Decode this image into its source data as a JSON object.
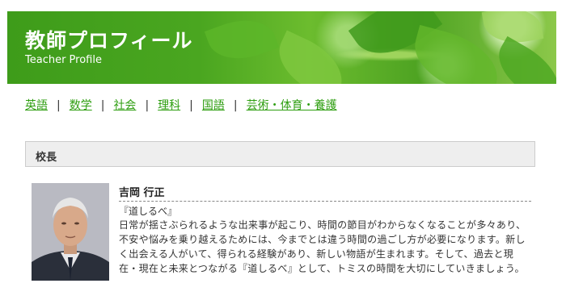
{
  "header": {
    "title": "教師プロフィール",
    "subtitle": "Teacher Profile"
  },
  "nav": {
    "items": [
      {
        "label": "英語"
      },
      {
        "label": "数学"
      },
      {
        "label": "社会"
      },
      {
        "label": "理科"
      },
      {
        "label": "国語"
      },
      {
        "label": "芸術・体育・養護"
      }
    ],
    "separators": [
      "|",
      "|",
      "|",
      "|",
      "|"
    ]
  },
  "section": {
    "heading": "校長"
  },
  "profile": {
    "name": "吉岡 行正",
    "motto": "『道しるべ』",
    "body": "日常が揺さぶられるような出来事が起こり、時間の節目がわからなくなることが多々あり、不安や悩みを乗り越えるためには、今までとは違う時間の過ごし方が必要になります。新しく出会える人がいて、得られる経験があり、新しい物語が生まれます。そして、過去と現在・現在と未来とつながる『道しるべ』として、トミスの時間を大切にしていきましょう。"
  },
  "colors": {
    "link": "#2e9e10",
    "banner": "#4aa620",
    "section_bg": "#eeeeee"
  }
}
